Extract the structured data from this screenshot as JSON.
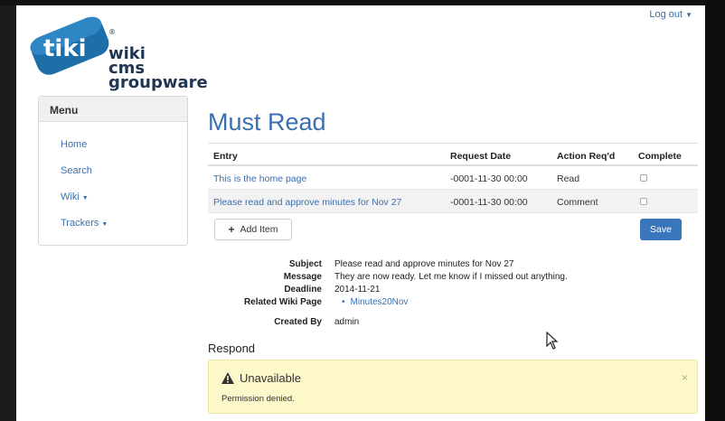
{
  "header": {
    "logout_label": "Log out"
  },
  "logo": {
    "mark": "tiki",
    "line1": "wiki",
    "line2": "cms",
    "line3": "groupware",
    "registered": "®"
  },
  "menu": {
    "title": "Menu",
    "items": [
      {
        "label": "Home",
        "has_caret": false
      },
      {
        "label": "Search",
        "has_caret": false
      },
      {
        "label": "Wiki",
        "has_caret": true
      },
      {
        "label": "Trackers",
        "has_caret": true
      }
    ]
  },
  "main": {
    "title": "Must Read",
    "table": {
      "headers": [
        "Entry",
        "Request Date",
        "Action Req'd",
        "Complete"
      ],
      "rows": [
        {
          "entry": "This is the home page",
          "date": "-0001-11-30 00:00",
          "action": "Read",
          "complete": false
        },
        {
          "entry": "Please read and approve minutes for Nov 27",
          "date": "-0001-11-30 00:00",
          "action": "Comment",
          "complete": false
        }
      ]
    },
    "add_item_label": "Add Item",
    "save_label": "Save",
    "details": {
      "subject_label": "Subject",
      "subject": "Please read and approve minutes for Nov 27",
      "message_label": "Message",
      "message": "They are now ready. Let me know if I missed out anything.",
      "deadline_label": "Deadline",
      "deadline": "2014-11-21",
      "related_label": "Related Wiki Page",
      "related_page": "Minutes20Nov",
      "created_by_label": "Created By",
      "created_by": "admin"
    },
    "respond_title": "Respond",
    "alert": {
      "title": "Unavailable",
      "message": "Permission denied.",
      "close": "×"
    }
  },
  "colors": {
    "link": "#3a6fb0",
    "primary_button": "#3a76bb",
    "logo_blue": "#1e6fa8",
    "alert_bg": "#fcf8c9"
  }
}
